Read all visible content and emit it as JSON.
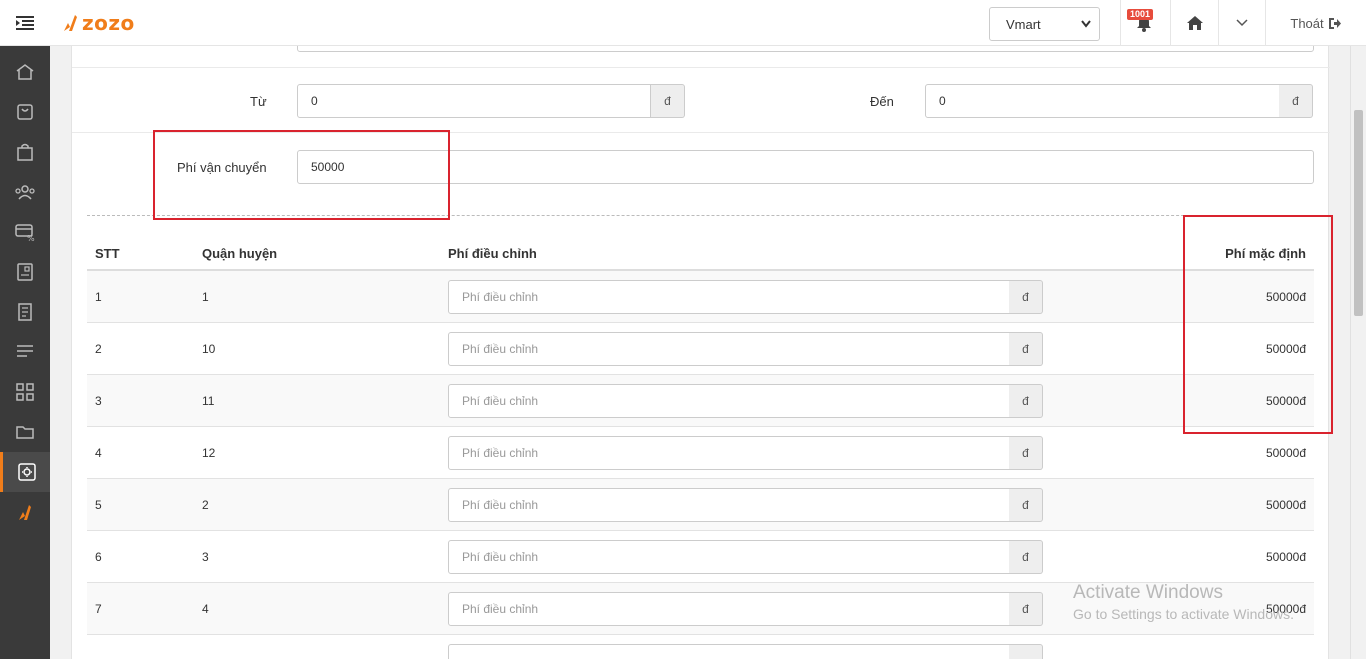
{
  "header": {
    "logo_text": "zozo",
    "store_selected": "Vmart",
    "notification_count": "1001",
    "logout_label": "Thoát"
  },
  "sidebar": {
    "items": [
      {
        "icon": "home-icon"
      },
      {
        "icon": "shopping-bag-icon"
      },
      {
        "icon": "bag-icon"
      },
      {
        "icon": "users-icon"
      },
      {
        "icon": "payment-card-icon"
      },
      {
        "icon": "device-icon"
      },
      {
        "icon": "report-icon"
      },
      {
        "icon": "list-icon"
      },
      {
        "icon": "apps-icon"
      },
      {
        "icon": "folder-icon"
      },
      {
        "icon": "settings-icon",
        "active": true
      },
      {
        "icon": "brand-icon"
      }
    ]
  },
  "form": {
    "from_label": "Từ",
    "from_value": "0",
    "from_unit": "đ",
    "to_label": "Đến",
    "to_value": "0",
    "to_unit": "đ",
    "shipping_label": "Phí vận chuyển",
    "shipping_value": "50000"
  },
  "table": {
    "headers": {
      "stt": "STT",
      "district": "Quận huyện",
      "adjust": "Phí điều chỉnh",
      "default": "Phí mặc định"
    },
    "input_placeholder": "Phí điều chỉnh",
    "unit": "đ",
    "rows": [
      {
        "stt": "1",
        "district": "1",
        "default": "50000đ"
      },
      {
        "stt": "2",
        "district": "10",
        "default": "50000đ"
      },
      {
        "stt": "3",
        "district": "11",
        "default": "50000đ"
      },
      {
        "stt": "4",
        "district": "12",
        "default": "50000đ"
      },
      {
        "stt": "5",
        "district": "2",
        "default": "50000đ"
      },
      {
        "stt": "6",
        "district": "3",
        "default": "50000đ"
      },
      {
        "stt": "7",
        "district": "4",
        "default": "50000đ"
      }
    ]
  },
  "watermark": {
    "line1": "Activate Windows",
    "line2": "Go to Settings to activate Windows."
  },
  "colors": {
    "accent": "#f07d1a",
    "highlight": "#d9232e",
    "sidebar": "#3a3a3a"
  }
}
